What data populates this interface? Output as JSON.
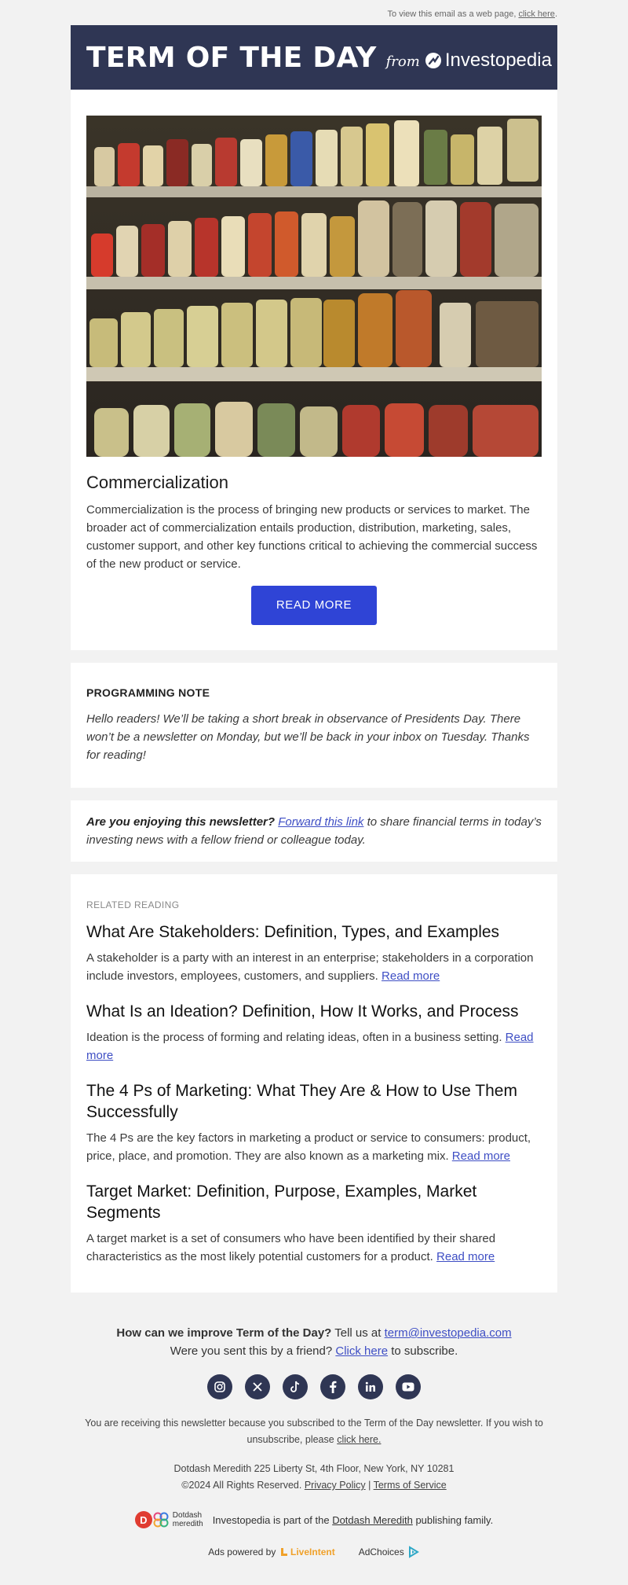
{
  "top_note": {
    "text": "To view this email as a web page,",
    "link": "click here",
    "period": "."
  },
  "banner": {
    "title": "TERM OF THE DAY",
    "from": "from",
    "brand": "Investopedia"
  },
  "term": {
    "title": "Commercialization",
    "description": "Commercialization is the process of bringing new products or services to market. The broader act of commercialization entails production, distribution, marketing, sales, customer support, and other key functions critical to achieving the commercial success of the new product or service.",
    "button": "READ MORE"
  },
  "note": {
    "heading": "PROGRAMMING NOTE",
    "body": "Hello readers! We’ll be taking a short break in observance of Presidents Day. There won’t be a newsletter on Monday, but we’ll be back in your inbox on Tuesday. Thanks for reading!"
  },
  "share": {
    "question": "Are you enjoying this newsletter?",
    "link": "Forward this link",
    "rest": "to share financial terms in today’s investing news with a fellow friend or colleague today."
  },
  "related": {
    "heading": "RELATED READING",
    "articles": [
      {
        "title": "What Are Stakeholders: Definition, Types, and Examples",
        "summary": "A stakeholder is a party with an interest in an enterprise; stakeholders in a corporation include investors, employees, customers, and suppliers.",
        "link": "Read more"
      },
      {
        "title": "What Is an Ideation? Definition, How It Works, and Process",
        "summary": "Ideation is the process of forming and relating ideas, often in a business setting.",
        "link": "Read more"
      },
      {
        "title": "The 4 Ps of Marketing: What They Are & How to Use Them Successfully",
        "summary": "The 4 Ps are the key factors in marketing a product or service to consumers: product, price, place, and promotion. They are also known as a marketing mix.",
        "link": "Read more"
      },
      {
        "title": "Target Market: Definition, Purpose, Examples, Market Segments",
        "summary": "A target market is a set of consumers who have been identified by their shared characteristics as the most likely potential customers for a product.",
        "link": "Read more"
      }
    ]
  },
  "footer": {
    "improve_q": "How can we improve Term of the Day?",
    "tell_us": "Tell us at",
    "email": "term@investopedia.com",
    "friend_q": "Were you sent this by a friend?",
    "click_here": "Click here",
    "to_subscribe": "to subscribe.",
    "socials": [
      "instagram-icon",
      "x-icon",
      "tiktok-icon",
      "facebook-icon",
      "linkedin-icon",
      "youtube-icon"
    ],
    "receiving": "You are receiving this newsletter because you subscribed to the Term of the Day newsletter. If you wish to unsubscribe, please",
    "unsubscribe": "click here.",
    "address": "Dotdash Meredith 225 Liberty St, 4th Floor, New York, NY 10281",
    "copyright": "©2024 All Rights Reserved.",
    "privacy": "Privacy Policy",
    "sep": "|",
    "terms": "Terms of Service",
    "dd_logo_top": "Dotdash",
    "dd_logo_bottom": "meredith",
    "family_pre": "Investopedia is part of the",
    "family_link": "Dotdash Meredith",
    "family_post": "publishing family.",
    "ads_powered": "Ads powered by",
    "liveintent": "LiveIntent",
    "adchoices": "AdChoices"
  }
}
